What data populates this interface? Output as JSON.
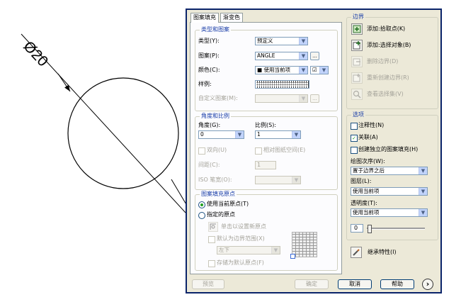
{
  "drawing": {
    "dimension_text": "Ø20"
  },
  "tabs": [
    {
      "label": "图案填充",
      "active": true
    },
    {
      "label": "渐变色",
      "active": false
    }
  ],
  "type_pattern": {
    "group_label": "类型和图案",
    "type_label": "类型(Y):",
    "type_value": "预定义",
    "pattern_label": "图案(P):",
    "pattern_value": "ANGLE",
    "browse_label": "...",
    "color_label": "颜色(C):",
    "color_value": "■ 使用当前项",
    "color_second": "☑",
    "swatch_label": "样例:",
    "custom_label": "自定义图案(M):",
    "custom_browse": "..."
  },
  "angle_scale": {
    "group_label": "角度和比例",
    "angle_label": "角度(G):",
    "angle_value": "0",
    "scale_label": "比例(S):",
    "scale_value": "1",
    "double_label": "双向(U)",
    "paperspace_label": "相对图纸空间(E)",
    "spacing_label": "间距(C):",
    "spacing_value": "1",
    "pen_label": "ISO 笔宽(O):",
    "pen_value": ""
  },
  "origin": {
    "group_label": "图案填充原点",
    "use_current_label": "使用当前原点(T)",
    "specified_label": "指定的原点",
    "click_set_label": "单击以设置新原点",
    "default_extent_label": "默认为边界范围(X)",
    "position_value": "左下",
    "store_label": "存储为默认原点(F)"
  },
  "boundaries": {
    "group_label": "边界",
    "add_pick_label": "添加:拾取点(K)",
    "add_select_label": "添加:选择对象(B)",
    "remove_label": "删除边界(D)",
    "recreate_label": "重新创建边界(R)",
    "view_label": "查看选择集(V)"
  },
  "options": {
    "group_label": "选项",
    "annotative_label": "注释性(N)",
    "associative_label": "关联(A)",
    "associative_checked": "✓",
    "separate_label": "创建独立的图案填充(H)",
    "draw_order_label": "绘图次序(W):",
    "draw_order_value": "置于边界之后",
    "layer_label": "图层(L):",
    "layer_value": "使用当前项",
    "transparency_label": "透明度(T):",
    "transparency_value": "使用当前项",
    "transparency_level": "0"
  },
  "inherit_label": "继承特性(I)",
  "footer": {
    "preview_label": "预览",
    "ok_label": "确定",
    "cancel_label": "取消",
    "help_label": "帮助",
    "more_icon": "›"
  }
}
